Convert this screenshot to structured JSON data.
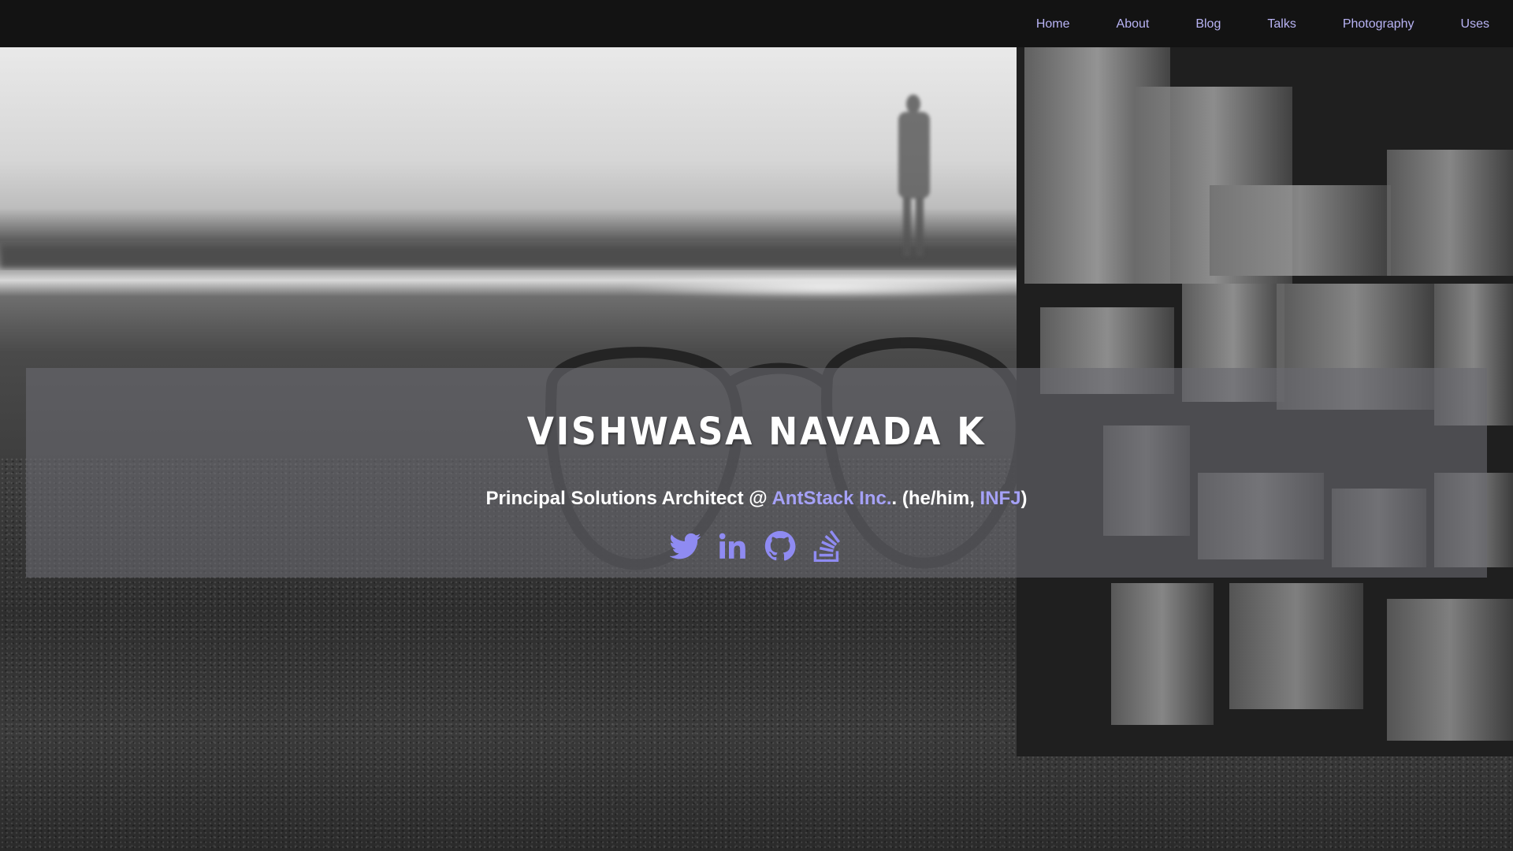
{
  "nav": {
    "items": [
      {
        "label": "Home"
      },
      {
        "label": "About"
      },
      {
        "label": "Blog"
      },
      {
        "label": "Talks"
      },
      {
        "label": "Photography"
      },
      {
        "label": "Uses"
      }
    ]
  },
  "hero": {
    "title": "VISHWASA NAVADA K",
    "tagline": {
      "prefix": "Principal Solutions Architect @ ",
      "company": "AntStack Inc.",
      "middle": ". (he/him, ",
      "personality": "INFJ",
      "suffix": ")"
    },
    "social": [
      {
        "icon": "twitter-icon"
      },
      {
        "icon": "linkedin-icon"
      },
      {
        "icon": "github-icon"
      },
      {
        "icon": "stackoverflow-icon"
      }
    ]
  },
  "colors": {
    "nav_background": "#131313",
    "nav_link": "#b9b4f5",
    "accent_link": "#a5a1f7",
    "icon": "#8f8bf2",
    "panel": "rgba(105,105,112,0.62)"
  }
}
